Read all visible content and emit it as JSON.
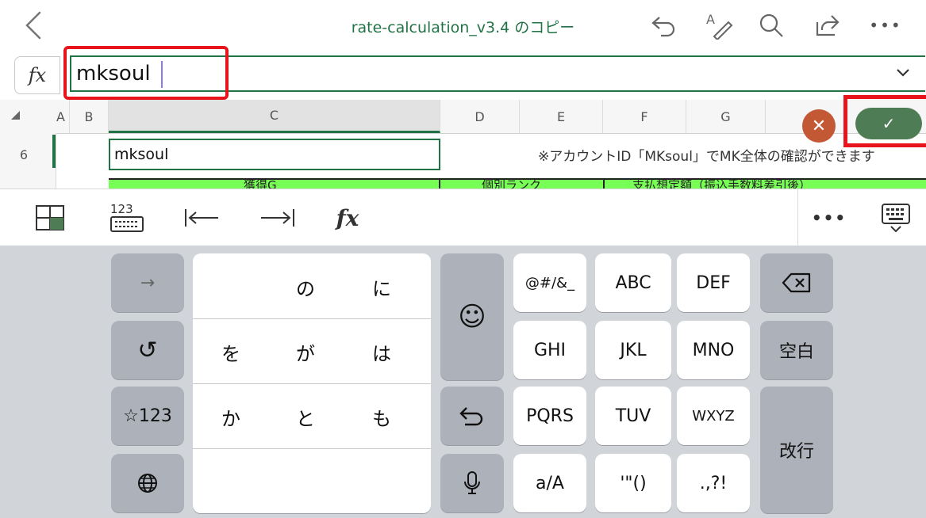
{
  "toolbar": {
    "title": "rate-calculation_v3.4 のコピー",
    "icons": [
      "back-chevron-icon",
      "undo-icon",
      "draw-icon",
      "search-icon",
      "share-icon",
      "more-icon"
    ]
  },
  "formula_bar": {
    "fx_label": "fx",
    "value": "mksoul"
  },
  "columns": [
    "A",
    "B",
    "C",
    "D",
    "E",
    "F",
    "G"
  ],
  "sheet": {
    "row_number": "6",
    "cell_c6": "mksoul",
    "note": "※アカウントID「MKsoul」でMK全体の確認ができます",
    "row8_labels": [
      "獲得G",
      "個別ランク",
      "支払想定額（振込手数料差引後）"
    ],
    "cancel_symbol": "✕",
    "confirm_symbol": "✓"
  },
  "shortcut_bar": {
    "fx_label": "fx",
    "more_label": "•••",
    "num_label": "123"
  },
  "keyboard": {
    "left_col": [
      "→",
      "↺",
      "☆123",
      "globe"
    ],
    "kana": [
      "の",
      "に",
      "を",
      "が",
      "は",
      "か",
      "と",
      "も"
    ],
    "emoji": "☺",
    "undo": "↶",
    "mic": "mic",
    "letters": [
      "@#/&_",
      "ABC",
      "DEF",
      "GHI",
      "JKL",
      "MNO",
      "PQRS",
      "TUV",
      "WXYZ",
      "a/A",
      "'\"()",
      ".,?!"
    ],
    "backspace": "⌫",
    "space": "空白",
    "enter": "改行"
  },
  "colors": {
    "accent": "#217346",
    "highlight": "#e8141c",
    "cancel": "#c35834",
    "confirm": "#4d7c55",
    "header_green": "#77ff55"
  }
}
